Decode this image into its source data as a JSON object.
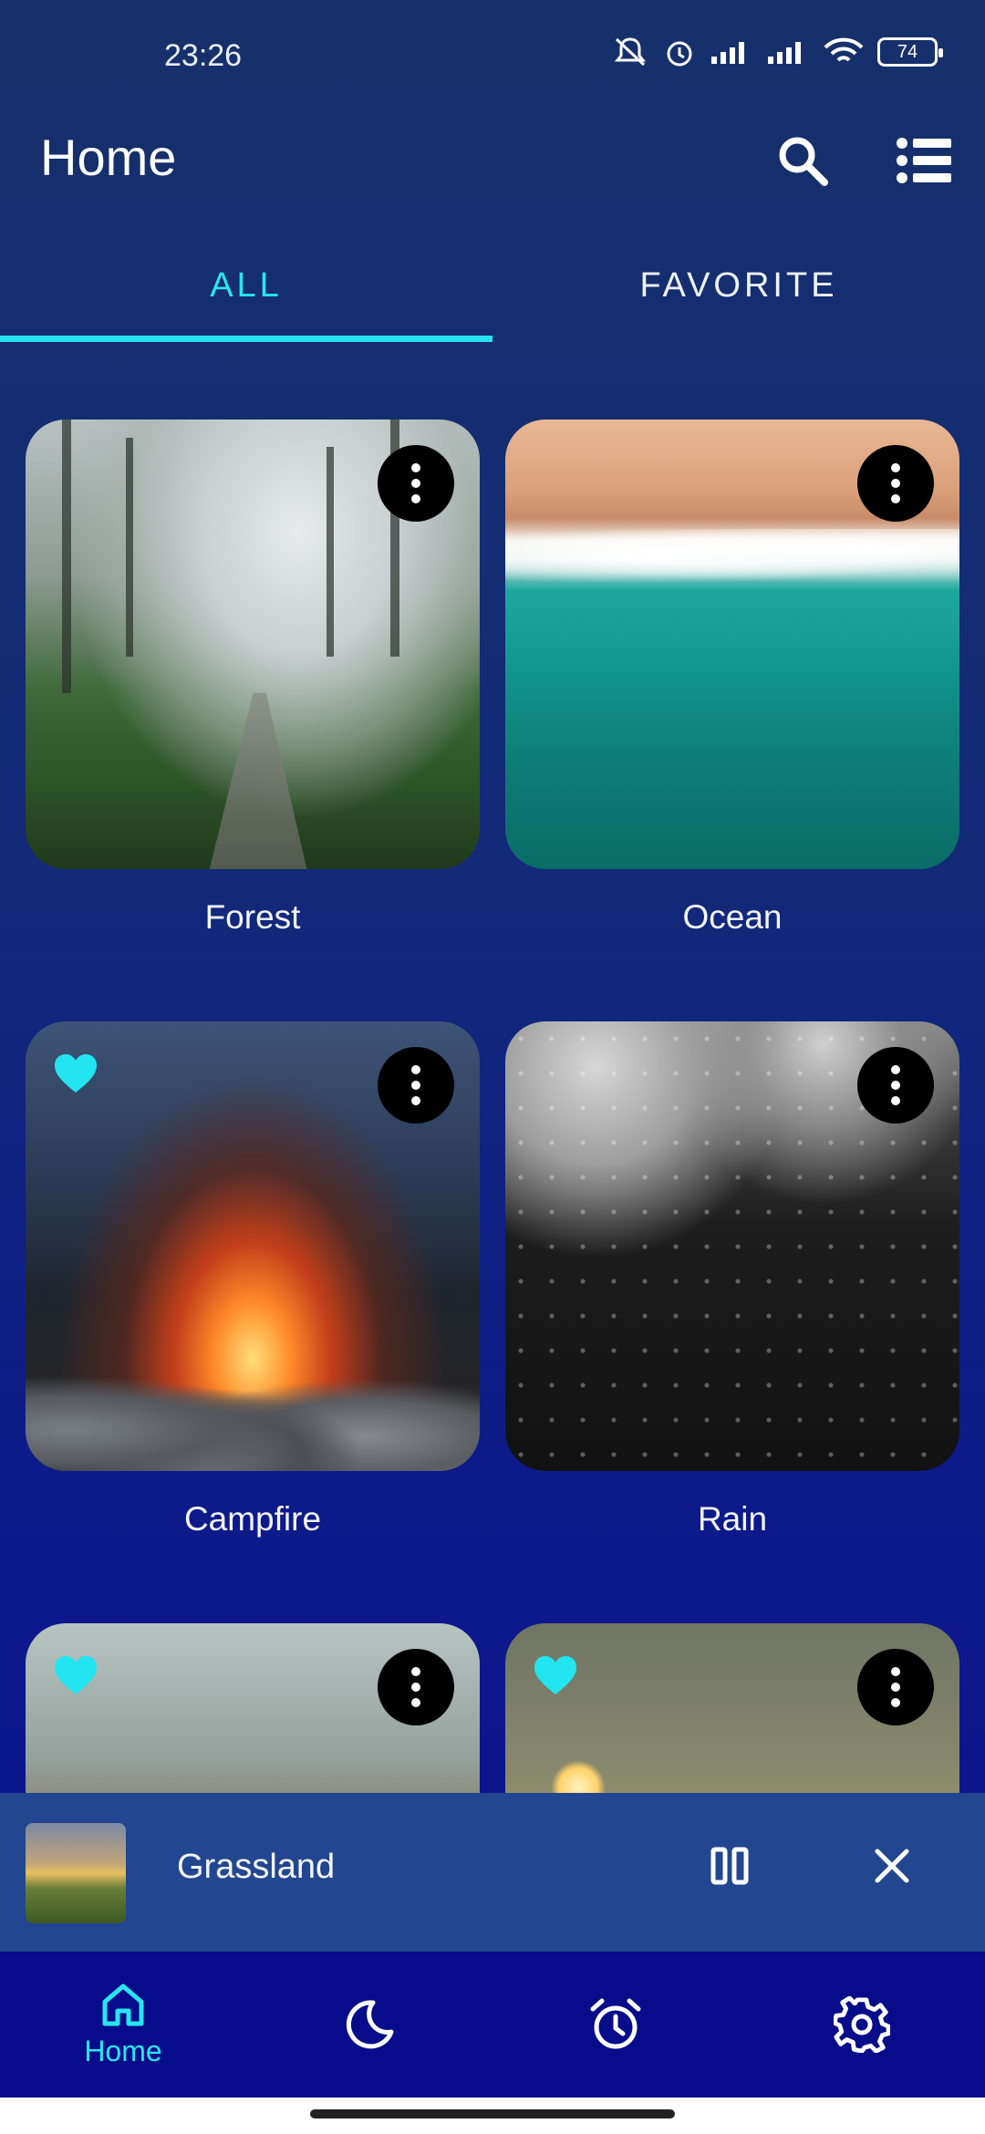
{
  "status_bar": {
    "time": "23:26",
    "battery": "74",
    "icons": [
      "mute-icon",
      "alarm-icon",
      "signal-icon",
      "signal-icon",
      "wifi-icon",
      "battery-icon"
    ]
  },
  "app_bar": {
    "title": "Home",
    "actions": [
      "search-icon",
      "list-icon"
    ]
  },
  "tabs": [
    {
      "label": "ALL",
      "selected": true
    },
    {
      "label": "FAVORITE",
      "selected": false
    }
  ],
  "sounds": [
    {
      "name": "Forest",
      "favorite": false
    },
    {
      "name": "Ocean",
      "favorite": false
    },
    {
      "name": "Campfire",
      "favorite": true
    },
    {
      "name": "Rain",
      "favorite": false
    },
    {
      "name": "",
      "favorite": true
    },
    {
      "name": "",
      "favorite": true
    }
  ],
  "mini_player": {
    "title": "Grassland",
    "state": "playing"
  },
  "bottom_nav": [
    {
      "label": "Home",
      "icon": "home-icon",
      "selected": true
    },
    {
      "label": "",
      "icon": "moon-icon",
      "selected": false
    },
    {
      "label": "",
      "icon": "alarm-clock-icon",
      "selected": false
    },
    {
      "label": "",
      "icon": "gear-icon",
      "selected": false
    }
  ],
  "colors": {
    "accent": "#26E3EF",
    "background_top": "#16306A",
    "background_bottom": "#0B118F",
    "mini_player_bg": "#22468F",
    "bottom_nav_bg": "#060C8A"
  }
}
